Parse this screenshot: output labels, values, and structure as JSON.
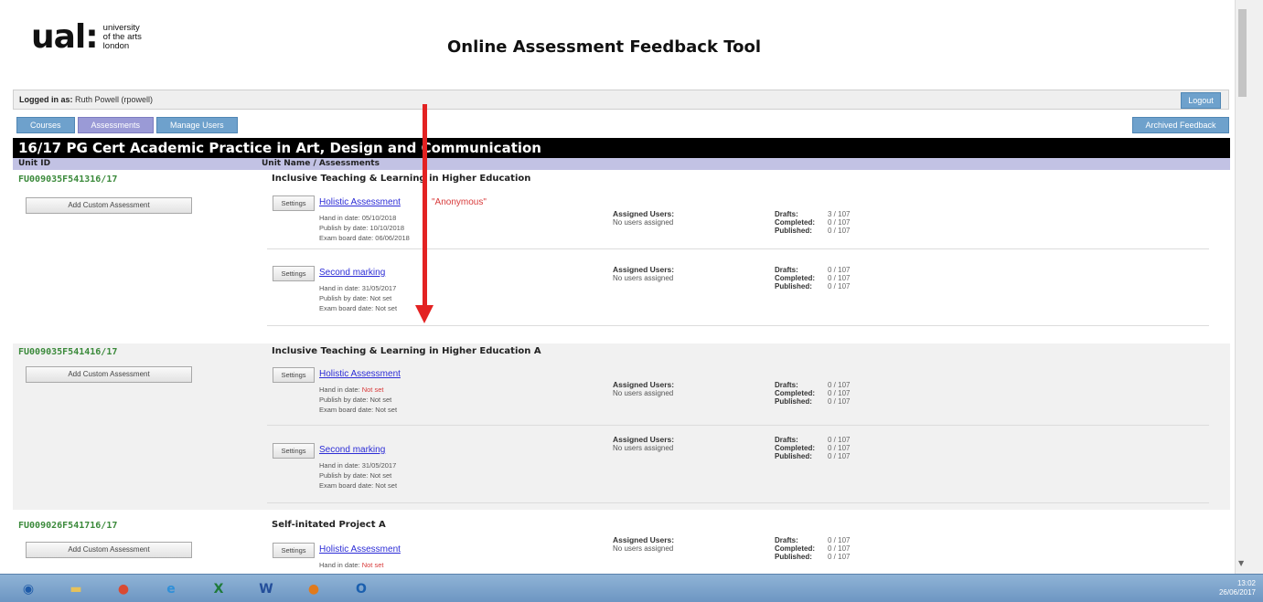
{
  "header": {
    "logo_mark": "ual:",
    "logo_line1": "university",
    "logo_line2": "of the arts",
    "logo_line3": "london",
    "app_title": "Online Assessment Feedback Tool"
  },
  "login": {
    "label": "Logged in as:",
    "user": "Ruth Powell (rpowell)",
    "logout_label": "Logout"
  },
  "tabs": [
    {
      "label": "Courses"
    },
    {
      "label": "Assessments"
    },
    {
      "label": "Manage Users"
    }
  ],
  "archived_label": "Archived Feedback",
  "course": {
    "title": "16/17 PG Cert Academic Practice in Art, Design and Communication",
    "col_unit_id": "Unit ID",
    "col_unit_name": "Unit Name / Assessments"
  },
  "labels": {
    "add_custom": "Add Custom Assessment",
    "settings": "Settings",
    "assigned_users": "Assigned Users:",
    "no_users": "No users assigned",
    "drafts": "Drafts:",
    "completed": "Completed:",
    "published": "Published:",
    "hand_in": "Hand in date:",
    "publish_by": "Publish by date:",
    "exam_board": "Exam board date:"
  },
  "units": [
    {
      "id": "FU009035F541316/17",
      "name": "Inclusive Teaching & Learning in Higher Education",
      "assessments": [
        {
          "name": "Holistic Assessment",
          "anonymous": "\"Anonymous\"",
          "hand_in": "05/10/2018",
          "publish_by": "10/10/2018",
          "exam_board": "06/06/2018",
          "drafts": "3 / 107",
          "completed": "0 / 107",
          "published": "0 / 107"
        },
        {
          "name": "Second marking",
          "hand_in": "31/05/2017",
          "publish_by": "Not set",
          "exam_board": "Not set",
          "drafts": "0 / 107",
          "completed": "0 / 107",
          "published": "0 / 107"
        }
      ]
    },
    {
      "id": "FU009035F541416/17",
      "name": "Inclusive Teaching & Learning in Higher Education A",
      "assessments": [
        {
          "name": "Holistic Assessment",
          "hand_in": "Not set",
          "publish_by": "Not set",
          "exam_board": "Not set",
          "drafts": "0 / 107",
          "completed": "0 / 107",
          "published": "0 / 107"
        },
        {
          "name": "Second marking",
          "hand_in": "31/05/2017",
          "publish_by": "Not set",
          "exam_board": "Not set",
          "drafts": "0 / 107",
          "completed": "0 / 107",
          "published": "0 / 107"
        }
      ]
    },
    {
      "id": "FU009026F541716/17",
      "name": "Self-initated Project A",
      "assessments": [
        {
          "name": "Holistic Assessment",
          "hand_in": "Not set",
          "drafts": "0 / 107",
          "completed": "0 / 107",
          "published": "0 / 107"
        }
      ]
    }
  ],
  "taskbar": {
    "time": "13:02",
    "date": "26/06/2017"
  }
}
